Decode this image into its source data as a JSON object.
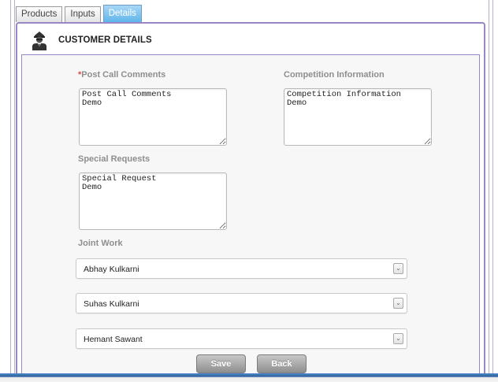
{
  "tabs": [
    {
      "label": "Products",
      "active": false
    },
    {
      "label": "Inputs",
      "active": false
    },
    {
      "label": "Details",
      "active": true
    }
  ],
  "section": {
    "title": "CUSTOMER DETAILS",
    "icon": "person-agent-icon"
  },
  "form": {
    "post_call_comments": {
      "required_mark": "*",
      "label": "Post Call Comments",
      "value": "Post Call Comments\nDemo"
    },
    "competition_information": {
      "label": "Competition Information",
      "value": "Competition Information\nDemo"
    },
    "special_requests": {
      "label": "Special Requests",
      "value": "Special Request\nDemo"
    },
    "joint_work": {
      "label": "Joint Work",
      "selects": [
        {
          "value": "Abhay Kulkarni"
        },
        {
          "value": "Suhas Kulkarni"
        },
        {
          "value": "Hemant Sawant"
        }
      ]
    }
  },
  "actions": {
    "save_label": "Save",
    "back_label": "Back"
  },
  "colors": {
    "panel_border": "#9a86c4",
    "active_tab": "#5fb5eb",
    "required": "#e04a3f",
    "button": "#9a9a9a"
  }
}
